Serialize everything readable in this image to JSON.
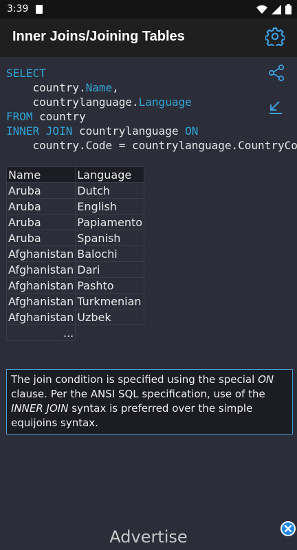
{
  "status_bar": {
    "time": "3:39"
  },
  "app_bar": {
    "title": "Inner Joins/Joining Tables"
  },
  "sql": {
    "line1": "SELECT",
    "line2_prefix": "    country.",
    "line2_field": "Name",
    "line2_suffix": ",",
    "line3_prefix": "    countrylanguage.",
    "line3_field": "Language",
    "line4_kw": "FROM",
    "line4_rest": " country",
    "line5_kw": "INNER JOIN",
    "line5_mid": " countrylanguage ",
    "line5_kw2": "ON",
    "line6": "    country.Code = countrylanguage.CountryCode"
  },
  "table": {
    "headers": [
      "Name",
      "Language"
    ],
    "rows": [
      [
        "Aruba",
        "Dutch"
      ],
      [
        "Aruba",
        "English"
      ],
      [
        "Aruba",
        "Papiamento"
      ],
      [
        "Aruba",
        "Spanish"
      ],
      [
        "Afghanistan",
        "Balochi"
      ],
      [
        "Afghanistan",
        "Dari"
      ],
      [
        "Afghanistan",
        "Pashto"
      ],
      [
        "Afghanistan",
        "Turkmenian"
      ],
      [
        "Afghanistan",
        "Uzbek"
      ]
    ],
    "more": "..."
  },
  "note": {
    "part1": "The join condition is specified using the special ",
    "em1": "ON",
    "part2": " clause. Per the ANSI SQL specification, use of the ",
    "em2": "INNER JOIN",
    "part3": " syntax is preferred over the simple equijoins syntax."
  },
  "ad": {
    "label": "Advertise"
  },
  "colors": {
    "keyword": "#2fa7d6",
    "accent": "#4d9dd0",
    "background": "#2b2d39"
  }
}
